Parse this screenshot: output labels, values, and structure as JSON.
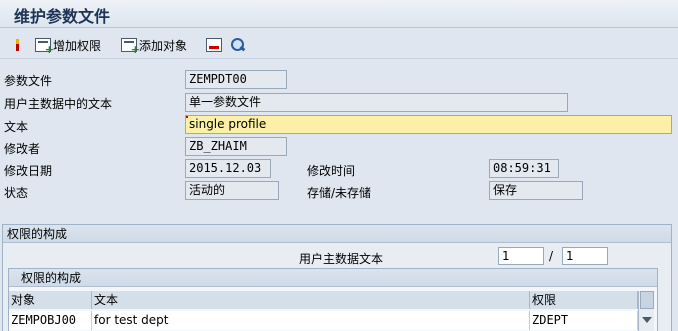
{
  "window": {
    "title": "维护参数文件"
  },
  "toolbar": {
    "add_auth_label": "增加权限",
    "add_object_label": "添加对象"
  },
  "form": {
    "profile": {
      "label": "参数文件",
      "value": "ZEMPDT00"
    },
    "master_text": {
      "label": "用户主数据中的文本",
      "value": "单一参数文件"
    },
    "text": {
      "label": "文本",
      "value": "single profile"
    },
    "modified_by": {
      "label": "修改者",
      "value": "ZB_ZHAIM"
    },
    "modified_date": {
      "label": "修改日期",
      "value": "2015.12.03"
    },
    "modified_time": {
      "label": "修改时间",
      "value": "08:59:31"
    },
    "status": {
      "label": "状态",
      "value": "活动的"
    },
    "save_state": {
      "label": "存储/未存储",
      "value": "保存"
    }
  },
  "auth_group": {
    "title": "权限的构成",
    "master_text_label": "用户主数据文本",
    "page_current": "1",
    "page_separator": "/",
    "page_total": "1",
    "table": {
      "title": "权限的构成",
      "columns": [
        "对象",
        "文本",
        "权限"
      ],
      "rows": [
        [
          "ZEMPOBJ00",
          "for test dept",
          "ZDEPT"
        ]
      ]
    }
  },
  "colors": {
    "accent_title": "#1d3455",
    "edit_field_bg": "#fbf0a6",
    "background": "#dfe6ef"
  },
  "icons": [
    "marker-icon",
    "add-authorization-icon",
    "add-object-icon",
    "delete-icon",
    "find-icon"
  ]
}
